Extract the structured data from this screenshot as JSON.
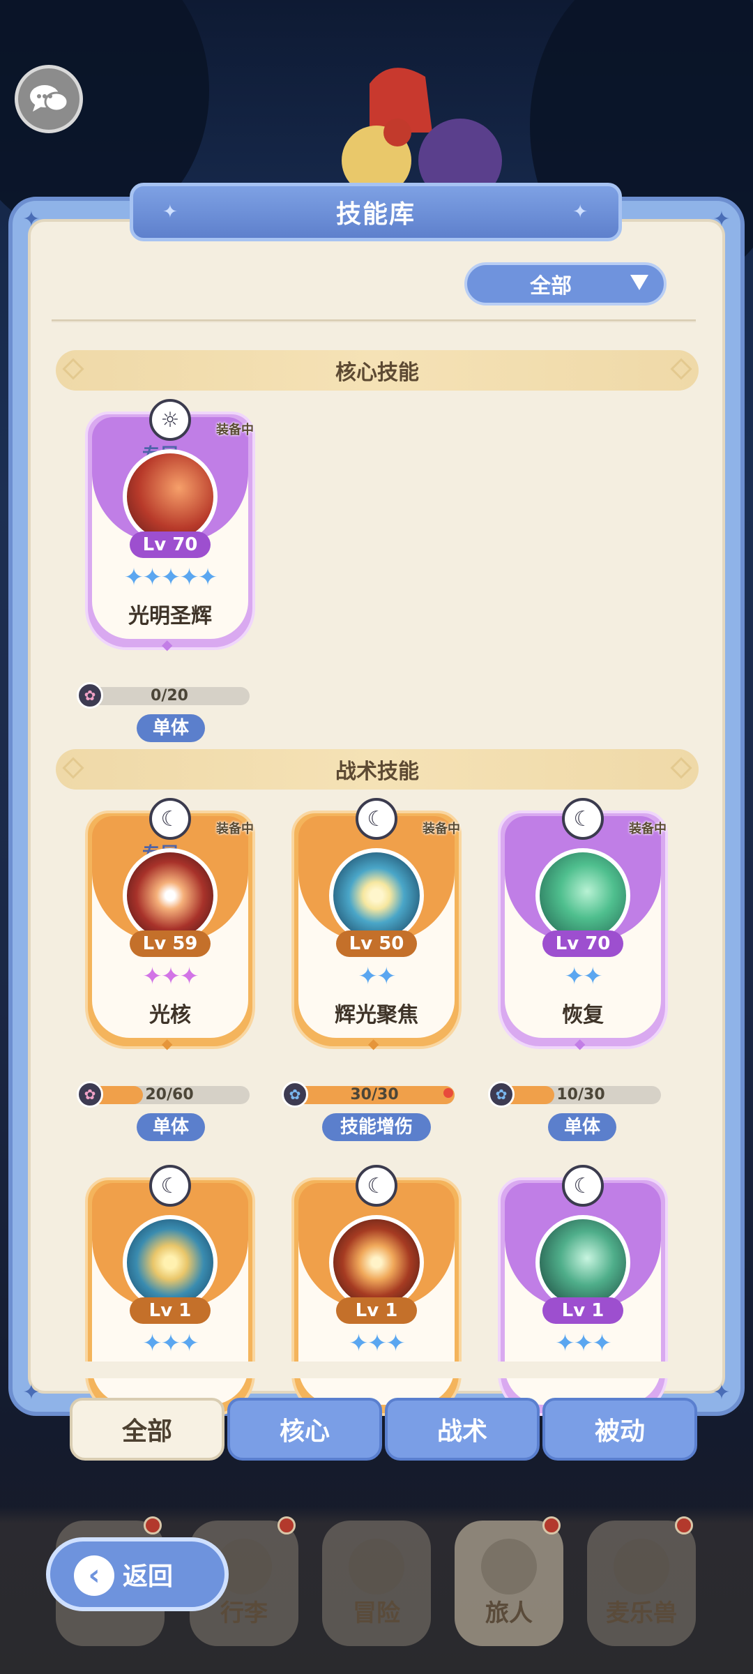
{
  "header": {
    "title": "技能库"
  },
  "filter": {
    "selected": "全部"
  },
  "sections": {
    "core": "核心技能",
    "tactical": "战术技能"
  },
  "cards": [
    {
      "name": "光明圣辉",
      "level": "Lv 70",
      "exclusive": "专属",
      "equipped": "装备中",
      "stars": "✦✦✦✦✦",
      "progress": "0/20",
      "progress_value": 0,
      "tag": "单体",
      "theme": "purple"
    },
    {
      "name": "光核",
      "level": "Lv 59",
      "exclusive": "专属",
      "equipped": "装备中",
      "stars": "✦✦✦",
      "progress": "20/60",
      "progress_value": 0.333,
      "tag": "单体",
      "theme": "orange"
    },
    {
      "name": "辉光聚焦",
      "level": "Lv 50",
      "exclusive": "",
      "equipped": "装备中",
      "stars": "✦✦",
      "progress": "30/30",
      "progress_value": 1.0,
      "tag": "技能增伤",
      "theme": "orange"
    },
    {
      "name": "恢复",
      "level": "Lv 70",
      "exclusive": "",
      "equipped": "装备中",
      "stars": "✦✦",
      "progress": "10/30",
      "progress_value": 0.333,
      "tag": "单体",
      "theme": "purple"
    },
    {
      "name": "",
      "level": "Lv 1",
      "exclusive": "",
      "equipped": "",
      "stars": "✦✦✦",
      "theme": "orange"
    },
    {
      "name": "",
      "level": "Lv 1",
      "exclusive": "",
      "equipped": "",
      "stars": "✦✦✦",
      "theme": "orange"
    },
    {
      "name": "",
      "level": "Lv 1",
      "exclusive": "",
      "equipped": "",
      "stars": "✦✦✦",
      "theme": "purple"
    }
  ],
  "tabs": [
    {
      "label": "全部",
      "active": true
    },
    {
      "label": "核心",
      "active": false
    },
    {
      "label": "战术",
      "active": false
    },
    {
      "label": "被动",
      "active": false
    }
  ],
  "nav": [
    {
      "label": "行李"
    },
    {
      "label": "冒险"
    },
    {
      "label": "旅人"
    },
    {
      "label": "麦乐兽"
    }
  ],
  "back": {
    "label": "返回"
  }
}
